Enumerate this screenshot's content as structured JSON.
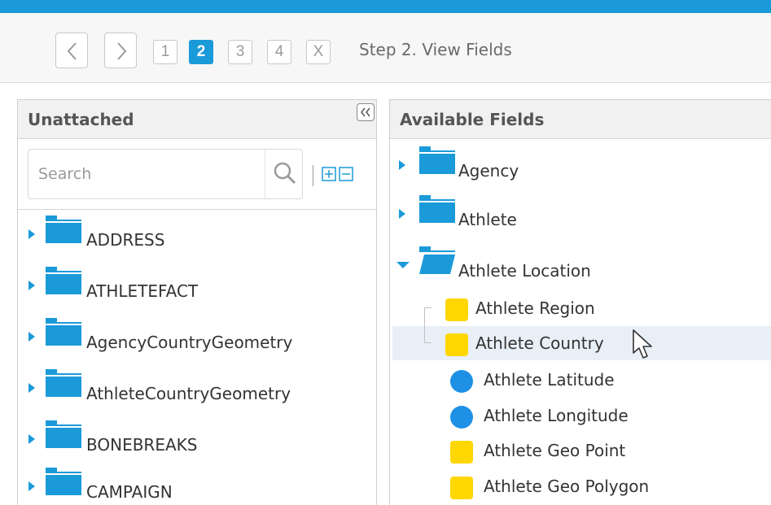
{
  "toolbar": {
    "steps": [
      "1",
      "2",
      "3",
      "4",
      "X"
    ],
    "active_step": "2",
    "title": "Step 2. View Fields"
  },
  "colors": {
    "accent": "#1b9ad9",
    "dimension_field": "#ffd700",
    "measure_field": "#1e90e6"
  },
  "left_panel": {
    "title": "Unattached",
    "search_placeholder": "Search",
    "items": [
      {
        "label": "ADDRESS",
        "icon": "folder-icon"
      },
      {
        "label": "ATHLETEFACT",
        "icon": "folder-icon"
      },
      {
        "label": "AgencyCountryGeometry",
        "icon": "folder-icon"
      },
      {
        "label": "AthleteCountryGeometry",
        "icon": "folder-icon"
      },
      {
        "label": "BONEBREAKS",
        "icon": "folder-icon"
      },
      {
        "label": "CAMPAIGN",
        "icon": "folder-icon"
      }
    ]
  },
  "right_panel": {
    "title": "Available Fields",
    "folders": [
      {
        "label": "Agency",
        "expanded": false
      },
      {
        "label": "Athlete",
        "expanded": false
      },
      {
        "label": "Athlete Location",
        "expanded": true
      }
    ],
    "fields": [
      {
        "label": "Athlete Region",
        "type": "dimension"
      },
      {
        "label": "Athlete Country",
        "type": "dimension"
      },
      {
        "label": "Athlete Latitude",
        "type": "measure"
      },
      {
        "label": "Athlete Longitude",
        "type": "measure"
      },
      {
        "label": "Athlete Geo Point",
        "type": "dimension"
      },
      {
        "label": "Athlete Geo Polygon",
        "type": "dimension"
      }
    ]
  }
}
